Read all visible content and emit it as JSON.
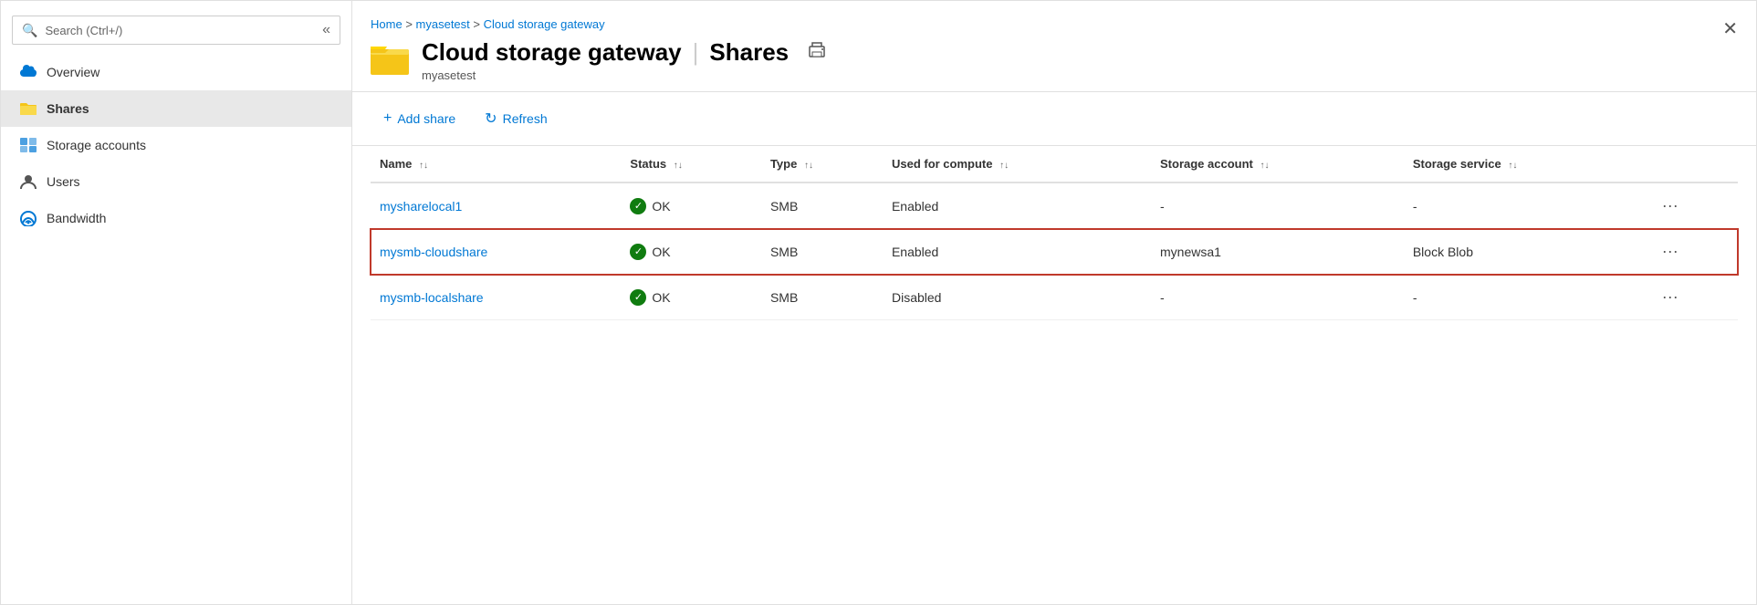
{
  "breadcrumb": {
    "home": "Home",
    "myasetest": "myasetest",
    "current": "Cloud storage gateway"
  },
  "header": {
    "icon": "📁",
    "title": "Cloud storage gateway",
    "separator": "|",
    "subtitle_label": "Shares",
    "device": "myasetest",
    "print_tooltip": "Print"
  },
  "toolbar": {
    "add_share": "Add share",
    "refresh": "Refresh"
  },
  "table": {
    "columns": [
      {
        "label": "Name",
        "key": "name"
      },
      {
        "label": "Status",
        "key": "status"
      },
      {
        "label": "Type",
        "key": "type"
      },
      {
        "label": "Used for compute",
        "key": "used_for_compute"
      },
      {
        "label": "Storage account",
        "key": "storage_account"
      },
      {
        "label": "Storage service",
        "key": "storage_service"
      }
    ],
    "rows": [
      {
        "name": "mysharelocal1",
        "status": "OK",
        "type": "SMB",
        "used_for_compute": "Enabled",
        "storage_account": "-",
        "storage_service": "-",
        "highlighted": false
      },
      {
        "name": "mysmb-cloudshare",
        "status": "OK",
        "type": "SMB",
        "used_for_compute": "Enabled",
        "storage_account": "mynewsa1",
        "storage_service": "Block Blob",
        "highlighted": true
      },
      {
        "name": "mysmb-localshare",
        "status": "OK",
        "type": "SMB",
        "used_for_compute": "Disabled",
        "storage_account": "-",
        "storage_service": "-",
        "highlighted": false
      }
    ]
  },
  "sidebar": {
    "search_placeholder": "Search (Ctrl+/)",
    "items": [
      {
        "id": "overview",
        "label": "Overview",
        "icon": "cloud",
        "active": false
      },
      {
        "id": "shares",
        "label": "Shares",
        "icon": "folder",
        "active": true
      },
      {
        "id": "storage-accounts",
        "label": "Storage accounts",
        "icon": "storage",
        "active": false
      },
      {
        "id": "users",
        "label": "Users",
        "icon": "user",
        "active": false
      },
      {
        "id": "bandwidth",
        "label": "Bandwidth",
        "icon": "bandwidth",
        "active": false
      }
    ]
  }
}
